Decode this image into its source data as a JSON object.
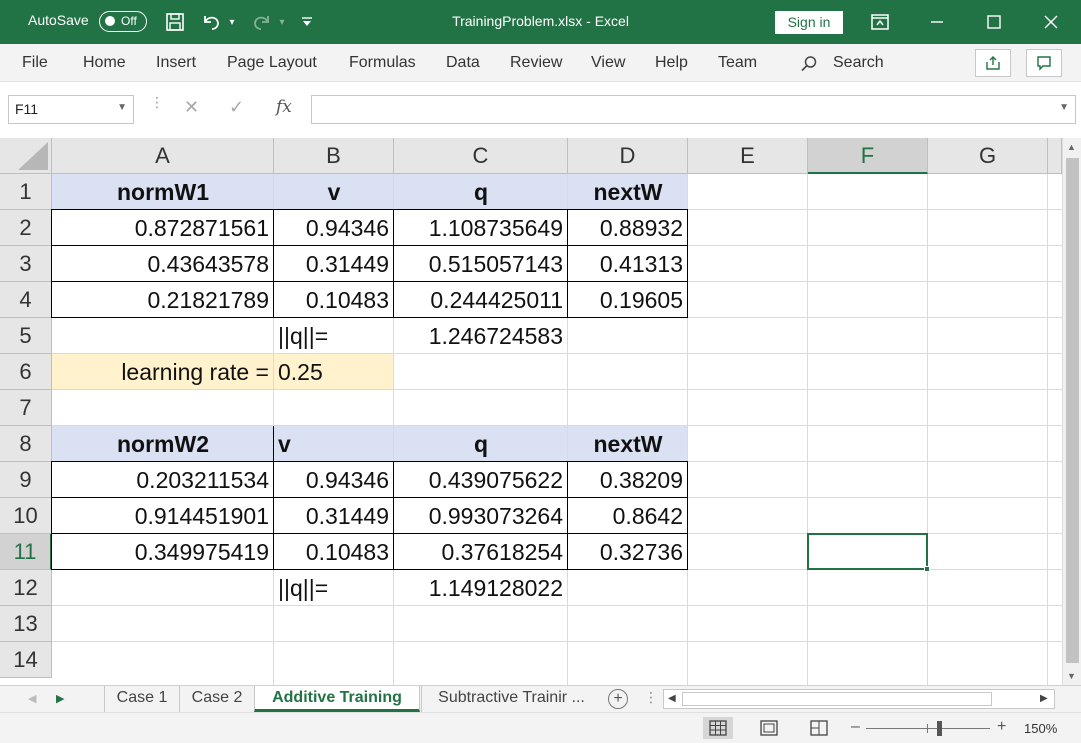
{
  "titlebar": {
    "autosave_label": "AutoSave",
    "autosave_state": "Off",
    "title": "TrainingProblem.xlsx  -  Excel",
    "signin_label": "Sign in"
  },
  "menu": {
    "items": [
      "File",
      "Home",
      "Insert",
      "Page Layout",
      "Formulas",
      "Data",
      "Review",
      "View",
      "Help",
      "Team"
    ],
    "search_label": "Search"
  },
  "formula_bar": {
    "name_box": "F11",
    "fx_label": "fx",
    "formula": ""
  },
  "sheet": {
    "columns": [
      "A",
      "B",
      "C",
      "D",
      "E",
      "F",
      "G"
    ],
    "rows": [
      "1",
      "2",
      "3",
      "4",
      "5",
      "6",
      "7",
      "8",
      "9",
      "10",
      "11",
      "12",
      "13",
      "14"
    ],
    "selected_column": "F",
    "selected_row": "11",
    "cells": {
      "A1": "normW1",
      "B1": "v",
      "C1": "q",
      "D1": "nextW",
      "A2": "0.872871561",
      "B2": "0.94346",
      "C2": "1.108735649",
      "D2": "0.88932",
      "A3": "0.43643578",
      "B3": "0.31449",
      "C3": "0.515057143",
      "D3": "0.41313",
      "A4": "0.21821789",
      "B4": "0.10483",
      "C4": "0.244425011",
      "D4": "0.19605",
      "B5": "||q||=",
      "C5": "1.246724583",
      "A6": "learning rate =",
      "B6": "0.25",
      "A8": "normW2",
      "B8": "v",
      "C8": "q",
      "D8": "nextW",
      "A9": "0.203211534",
      "B9": "0.94346",
      "C9": "0.439075622",
      "D9": "0.38209",
      "A10": "0.914451901",
      "B10": "0.31449",
      "C10": "0.993073264",
      "D10": "0.8642",
      "A11": "0.349975419",
      "B11": "0.10483",
      "C11": "0.37618254",
      "D11": "0.32736",
      "B12": "||q||=",
      "C12": "1.149128022"
    },
    "colors": {
      "header_fill": "#d9e1f2",
      "learning_rate_fill": "#fff2cc",
      "accent": "#217346"
    }
  },
  "tabs": {
    "sheets": [
      "Case 1",
      "Case 2",
      "Additive Training",
      "Subtractive Trainir ..."
    ],
    "active": "Additive Training"
  },
  "status": {
    "zoom": "150%"
  }
}
